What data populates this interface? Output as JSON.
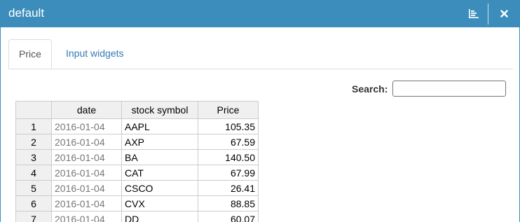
{
  "window": {
    "title": "default"
  },
  "tabs": [
    {
      "label": "Price",
      "active": true
    },
    {
      "label": "Input widgets",
      "active": false
    }
  ],
  "search": {
    "label": "Search:",
    "value": ""
  },
  "table": {
    "columns": [
      "",
      "date",
      "stock symbol",
      "Price"
    ],
    "rows": [
      {
        "index": "1",
        "date": "2016-01-04",
        "symbol": "AAPL",
        "price": "105.35"
      },
      {
        "index": "2",
        "date": "2016-01-04",
        "symbol": "AXP",
        "price": "67.59"
      },
      {
        "index": "3",
        "date": "2016-01-04",
        "symbol": "BA",
        "price": "140.50"
      },
      {
        "index": "4",
        "date": "2016-01-04",
        "symbol": "CAT",
        "price": "67.99"
      },
      {
        "index": "5",
        "date": "2016-01-04",
        "symbol": "CSCO",
        "price": "26.41"
      },
      {
        "index": "6",
        "date": "2016-01-04",
        "symbol": "CVX",
        "price": "88.85"
      },
      {
        "index": "7",
        "date": "2016-01-04",
        "symbol": "DD",
        "price": "60.07"
      }
    ]
  },
  "colors": {
    "titlebar": "#3c8dbc",
    "link": "#337ab7",
    "header_bg": "#f0f0f0",
    "grid_border": "#cccccc"
  },
  "icons": {
    "chart": "bar-chart-icon",
    "close": "close-icon"
  }
}
